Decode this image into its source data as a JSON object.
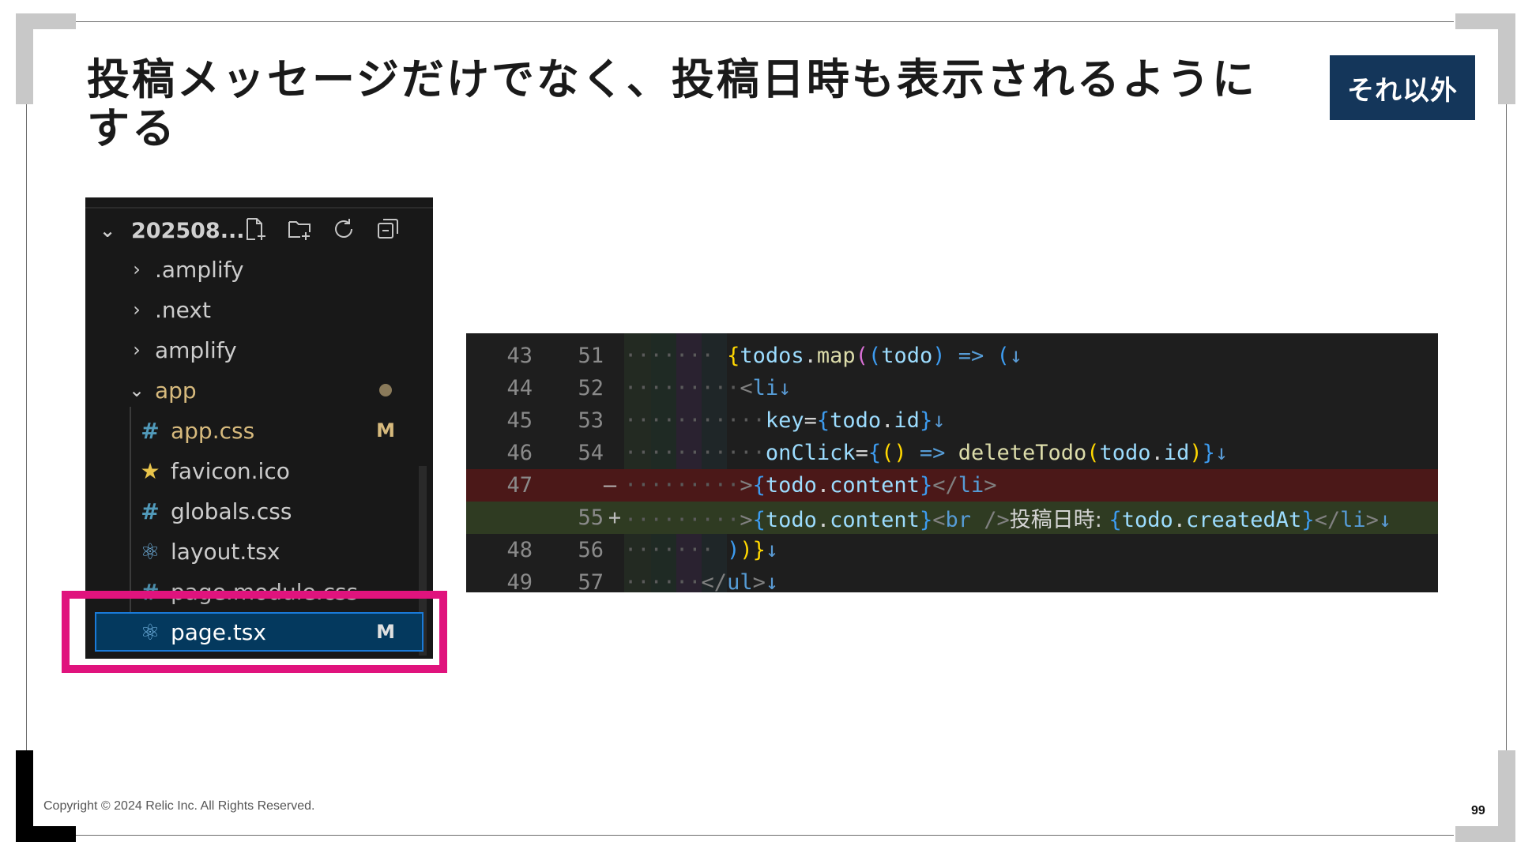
{
  "slide": {
    "title": "投稿メッセージだけでなく、投稿日時も表示されるようにする",
    "badge": "それ以外",
    "footer": "Copyright © 2024 Relic Inc. All Rights Reserved.",
    "page_number": "99"
  },
  "explorer": {
    "root_label": "202508...",
    "actions": [
      "new-file-icon",
      "new-folder-icon",
      "refresh-icon",
      "collapse-all-icon"
    ],
    "items": [
      {
        "label": ".amplify",
        "type": "folder",
        "expanded": false
      },
      {
        "label": ".next",
        "type": "folder",
        "expanded": false
      },
      {
        "label": "amplify",
        "type": "folder",
        "expanded": false
      },
      {
        "label": "app",
        "type": "folder",
        "expanded": true
      },
      {
        "label": "app.css",
        "type": "css",
        "status": "M"
      },
      {
        "label": "favicon.ico",
        "type": "ico"
      },
      {
        "label": "globals.css",
        "type": "css"
      },
      {
        "label": "layout.tsx",
        "type": "tsx"
      },
      {
        "label": "page.module.css",
        "type": "css"
      },
      {
        "label": "page.tsx",
        "type": "tsx",
        "status": "M",
        "selected": true
      }
    ],
    "icons": {
      "hash": "#",
      "star": "★",
      "react": "⚛",
      "chevron_right": "›",
      "chevron_down": "⌄"
    }
  },
  "diff": {
    "rows": [
      {
        "old": "43",
        "new": "51",
        "mark": "",
        "kind": "ctx",
        "t1": "",
        "t2": "{todos.map((todo) => (↓"
      },
      {
        "old": "44",
        "new": "52",
        "mark": "",
        "kind": "ctx",
        "t2": "<li↓"
      },
      {
        "old": "45",
        "new": "53",
        "mark": "",
        "kind": "ctx",
        "t2": "key={todo.id}↓"
      },
      {
        "old": "46",
        "new": "54",
        "mark": "",
        "kind": "ctx",
        "t2": "onClick={() => deleteTodo(todo.id)}↓"
      },
      {
        "old": "47",
        "new": "",
        "mark": "—",
        "kind": "del",
        "t2": ">{todo.content}</li>"
      },
      {
        "old": "",
        "new": "55",
        "mark": "+",
        "kind": "add",
        "t2": ">{todo.content}<br />投稿日時: {todo.createdAt}</li>↓"
      },
      {
        "old": "48",
        "new": "56",
        "mark": "",
        "kind": "ctx",
        "t2": "))}↓"
      },
      {
        "old": "49",
        "new": "57",
        "mark": "",
        "kind": "ctx",
        "t2": "</ul>↓"
      }
    ],
    "tokens": {
      "r0": [
        "{",
        "todos",
        ".",
        "map",
        "(",
        "(",
        "todo",
        ")",
        " => ",
        "(",
        "↓"
      ],
      "r1": [
        "<",
        "li",
        "↓"
      ],
      "r2": [
        "key",
        "=",
        "{",
        "todo",
        ".",
        "id",
        "}",
        "↓"
      ],
      "r3": [
        "onClick",
        "=",
        "{",
        "(",
        ")",
        " => ",
        "deleteTodo",
        "(",
        "todo",
        ".",
        "id",
        ")",
        "}",
        "↓"
      ],
      "r4": [
        ">",
        "{",
        "todo",
        ".",
        "content",
        "}",
        "</",
        "li",
        ">"
      ],
      "r5": [
        ">",
        "{",
        "todo",
        ".",
        "content",
        "}",
        "<",
        "br",
        " />",
        "投稿日時: ",
        "{",
        "todo",
        ".",
        "createdAt",
        "}",
        "</",
        "li",
        ">",
        "↓"
      ],
      "r6": [
        ")",
        ")",
        "}",
        "↓"
      ],
      "r7": [
        "</",
        "ul",
        ">",
        "↓"
      ]
    },
    "dots": {
      "d7": "·······",
      "d9": "·········",
      "d11": "···········",
      "d6": "······"
    }
  }
}
